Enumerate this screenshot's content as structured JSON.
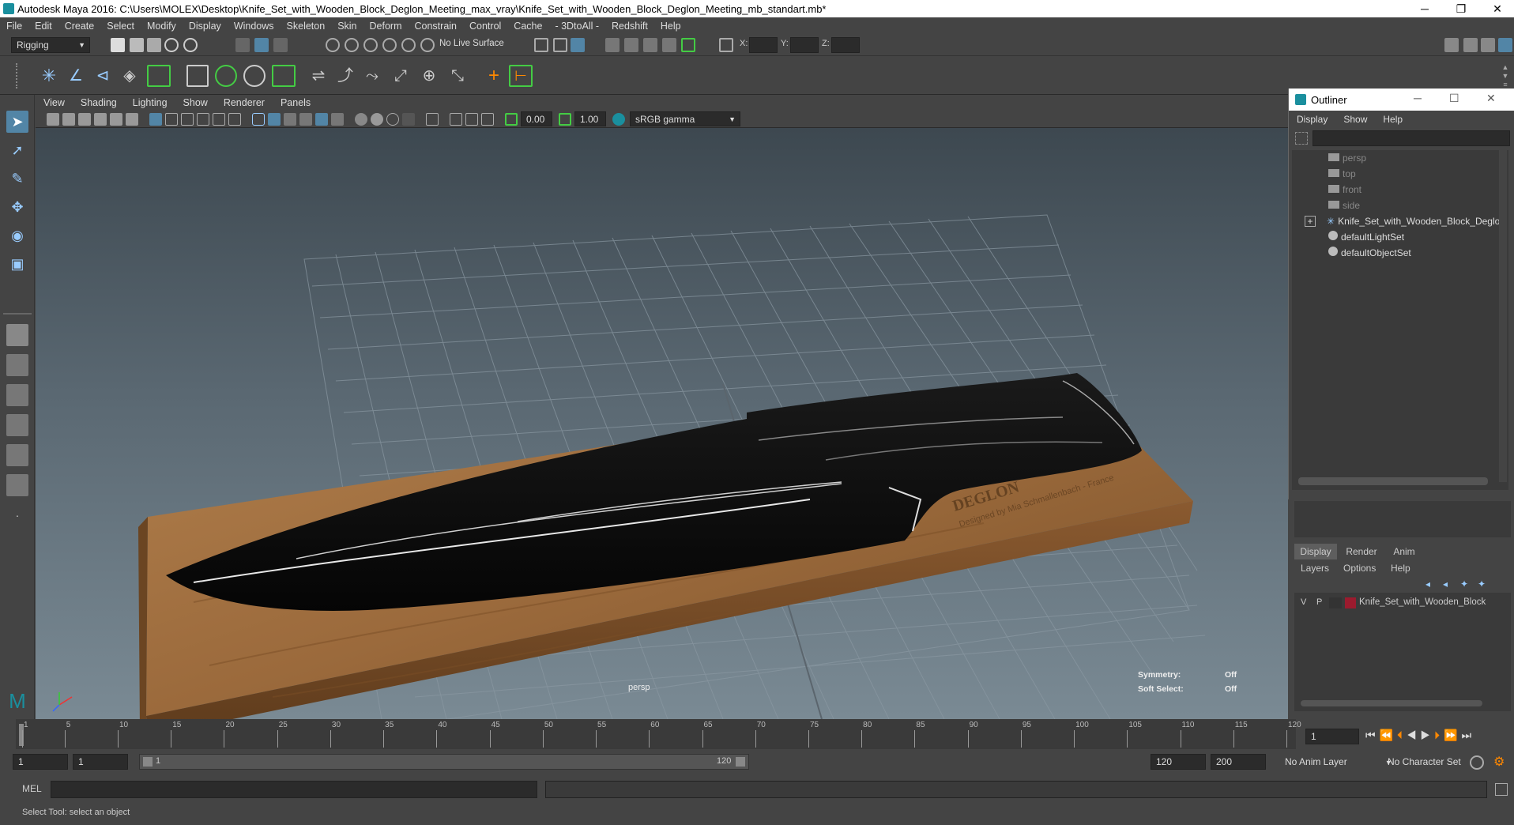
{
  "window": {
    "title": "Autodesk Maya 2016: C:\\Users\\MOLEX\\Desktop\\Knife_Set_with_Wooden_Block_Deglon_Meeting_max_vray\\Knife_Set_with_Wooden_Block_Deglon_Meeting_mb_standart.mb*",
    "minimize": "─",
    "restore": "❐",
    "close": "✕"
  },
  "menubar": [
    "File",
    "Edit",
    "Create",
    "Select",
    "Modify",
    "Display",
    "Windows",
    "Skeleton",
    "Skin",
    "Deform",
    "Constrain",
    "Control",
    "Cache",
    "- 3DtoAll -",
    "Redshift",
    "Help"
  ],
  "shelf": {
    "mode": "Rigging",
    "live_surface": "No Live Surface",
    "x_label": "X:",
    "y_label": "Y:",
    "z_label": "Z:"
  },
  "viewport": {
    "menu": [
      "View",
      "Shading",
      "Lighting",
      "Show",
      "Renderer",
      "Panels"
    ],
    "near_value": "0.00",
    "far_value": "1.00",
    "color_space": "sRGB gamma",
    "camera_label": "persp",
    "symmetry_label": "Symmetry:",
    "symmetry_value": "Off",
    "soft_select_label": "Soft Select:",
    "soft_select_value": "Off",
    "board_brand": "DEGLON",
    "board_tagline": "Designed by Mia Schmallenbach - France"
  },
  "outliner": {
    "title": "Outliner",
    "menu": [
      "Display",
      "Show",
      "Help"
    ],
    "items": [
      {
        "label": "persp",
        "dim": true
      },
      {
        "label": "top",
        "dim": true
      },
      {
        "label": "front",
        "dim": true
      },
      {
        "label": "side",
        "dim": true
      },
      {
        "label": "Knife_Set_with_Wooden_Block_Deglon",
        "dim": false
      },
      {
        "label": "defaultLightSet",
        "dim": false
      },
      {
        "label": "defaultObjectSet",
        "dim": false
      }
    ],
    "expand_symbol": "+"
  },
  "layers": {
    "tabs": [
      "Display",
      "Render",
      "Anim"
    ],
    "menu": [
      "Layers",
      "Options",
      "Help"
    ],
    "row_v": "V",
    "row_p": "P",
    "layer_name": "Knife_Set_with_Wooden_Block",
    "layer_color": "#9b1b2e"
  },
  "timeline": {
    "ticks": [
      "1",
      "5",
      "10",
      "15",
      "20",
      "25",
      "30",
      "35",
      "40",
      "45",
      "50",
      "55",
      "60",
      "65",
      "70",
      "75",
      "80",
      "85",
      "90",
      "95",
      "100",
      "105",
      "110",
      "115",
      "120"
    ],
    "current_frame": "1"
  },
  "range": {
    "start": "1",
    "playback_start": "1",
    "slider_start": "1",
    "slider_end": "120",
    "playback_end": "120",
    "end": "200",
    "anim_layer": "No Anim Layer",
    "character_set": "No Character Set"
  },
  "cmdline": {
    "label": "MEL"
  },
  "status": {
    "help_text": "Select Tool: select an object"
  },
  "colors": {
    "accent": "#5285a6",
    "wood": "#9b6a3c",
    "knife": "#0a0a0a"
  }
}
